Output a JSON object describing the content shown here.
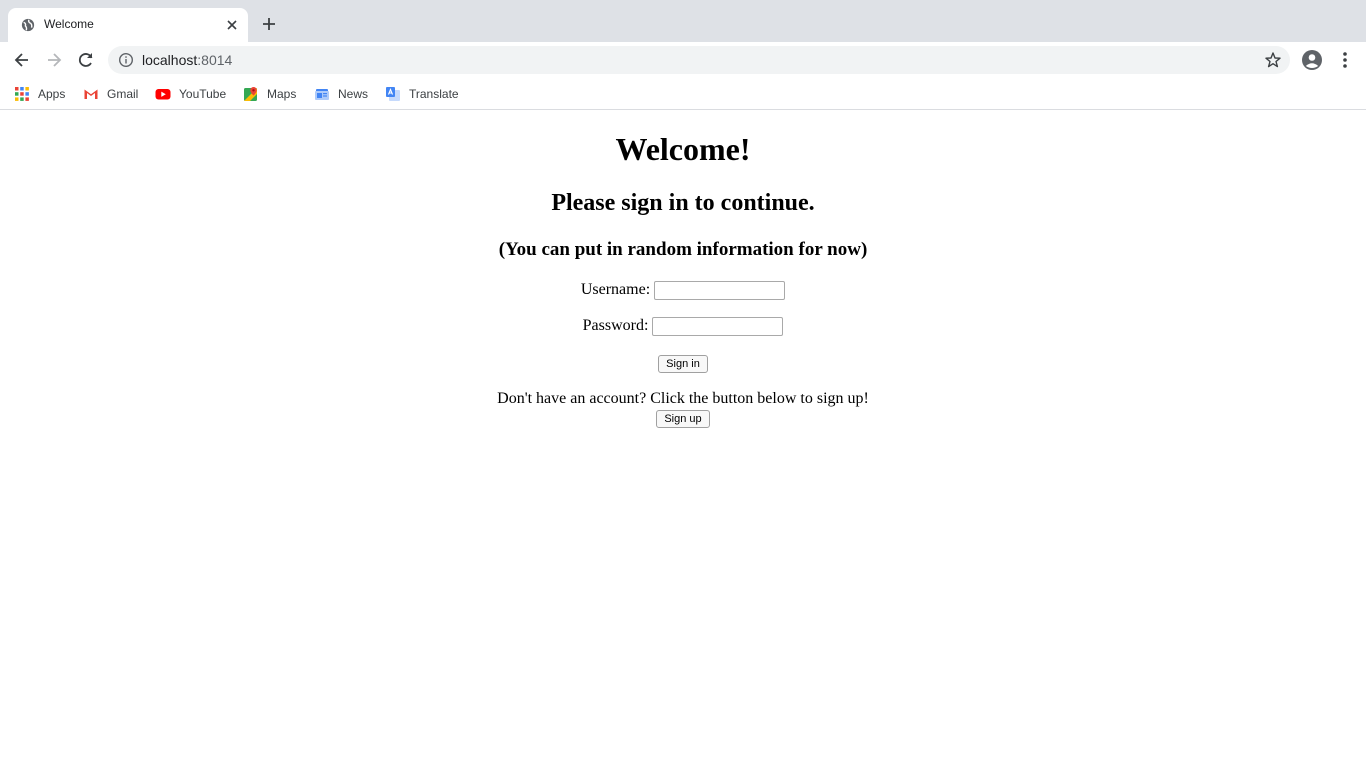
{
  "browser": {
    "tab": {
      "title": "Welcome"
    },
    "address": {
      "host": "localhost",
      "port": ":8014"
    },
    "bookmarks": [
      {
        "label": "Apps"
      },
      {
        "label": "Gmail"
      },
      {
        "label": "YouTube"
      },
      {
        "label": "Maps"
      },
      {
        "label": "News"
      },
      {
        "label": "Translate"
      }
    ]
  },
  "page": {
    "heading": "Welcome!",
    "subheading": "Please sign in to continue.",
    "note": "(You can put in random information for now)",
    "username_label": "Username:",
    "username_value": "",
    "password_label": "Password:",
    "password_value": "",
    "signin_label": "Sign in",
    "signup_prompt": "Don't have an account? Click the button below to sign up!",
    "signup_label": "Sign up"
  }
}
